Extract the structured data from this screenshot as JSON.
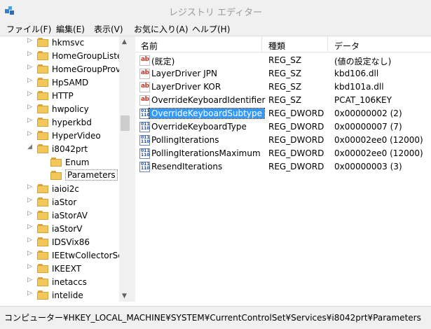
{
  "window": {
    "title": "レジストリ エディター"
  },
  "menu": [
    "ファイル(F)",
    "編集(E)",
    "表示(V)",
    "お気に入り(A)",
    "ヘルプ(H)"
  ],
  "tree": [
    {
      "label": "hkmsvc",
      "expander": "▷",
      "indent": 0
    },
    {
      "label": "HomeGroupListe",
      "expander": "▷",
      "indent": 0
    },
    {
      "label": "HomeGroupProv",
      "expander": "▷",
      "indent": 0
    },
    {
      "label": "HpSAMD",
      "expander": "▷",
      "indent": 0
    },
    {
      "label": "HTTP",
      "expander": "▷",
      "indent": 0
    },
    {
      "label": "hwpolicy",
      "expander": "▷",
      "indent": 0
    },
    {
      "label": "hyperkbd",
      "expander": "▷",
      "indent": 0
    },
    {
      "label": "HyperVideo",
      "expander": "▷",
      "indent": 0
    },
    {
      "label": "i8042prt",
      "expander": "◢",
      "indent": 0
    },
    {
      "label": "Enum",
      "expander": "",
      "indent": 1
    },
    {
      "label": "Parameters",
      "expander": "",
      "indent": 1,
      "selected": true
    },
    {
      "label": "iaioi2c",
      "expander": "▷",
      "indent": 0
    },
    {
      "label": "iaStor",
      "expander": "▷",
      "indent": 0
    },
    {
      "label": "iaStorAV",
      "expander": "▷",
      "indent": 0
    },
    {
      "label": "iaStorV",
      "expander": "▷",
      "indent": 0
    },
    {
      "label": "IDSVix86",
      "expander": "▷",
      "indent": 0
    },
    {
      "label": "IEEtwCollectorSe",
      "expander": "▷",
      "indent": 0
    },
    {
      "label": "IKEEXT",
      "expander": "▷",
      "indent": 0
    },
    {
      "label": "inetaccs",
      "expander": "▷",
      "indent": 0
    },
    {
      "label": "intelide",
      "expander": "▷",
      "indent": 0
    }
  ],
  "columns": {
    "name": "名前",
    "type": "種類",
    "data": "データ"
  },
  "values": [
    {
      "name": "(既定)",
      "type": "REG_SZ",
      "data": "(値の設定なし)",
      "icon": "ab"
    },
    {
      "name": "LayerDriver JPN",
      "type": "REG_SZ",
      "data": "kbd106.dll",
      "icon": "ab"
    },
    {
      "name": "LayerDriver KOR",
      "type": "REG_SZ",
      "data": "kbd101a.dll",
      "icon": "ab"
    },
    {
      "name": "OverrideKeyboardIdentifier",
      "type": "REG_SZ",
      "data": "PCAT_106KEY",
      "icon": "ab"
    },
    {
      "name": "OverrideKeyboardSubtype",
      "type": "REG_DWORD",
      "data": "0x00000002 (2)",
      "icon": "bin",
      "selected": true
    },
    {
      "name": "OverrideKeyboardType",
      "type": "REG_DWORD",
      "data": "0x00000007 (7)",
      "icon": "bin"
    },
    {
      "name": "PollingIterations",
      "type": "REG_DWORD",
      "data": "0x00002ee0 (12000)",
      "icon": "bin"
    },
    {
      "name": "PollingIterationsMaximum",
      "type": "REG_DWORD",
      "data": "0x00002ee0 (12000)",
      "icon": "bin"
    },
    {
      "name": "ResendIterations",
      "type": "REG_DWORD",
      "data": "0x00000003 (3)",
      "icon": "bin"
    }
  ],
  "status": "コンピューター¥HKEY_LOCAL_MACHINE¥SYSTEM¥CurrentControlSet¥Services¥i8042prt¥Parameters",
  "colors": {
    "selection": "#3399ff",
    "folder": "#f2c85b"
  }
}
